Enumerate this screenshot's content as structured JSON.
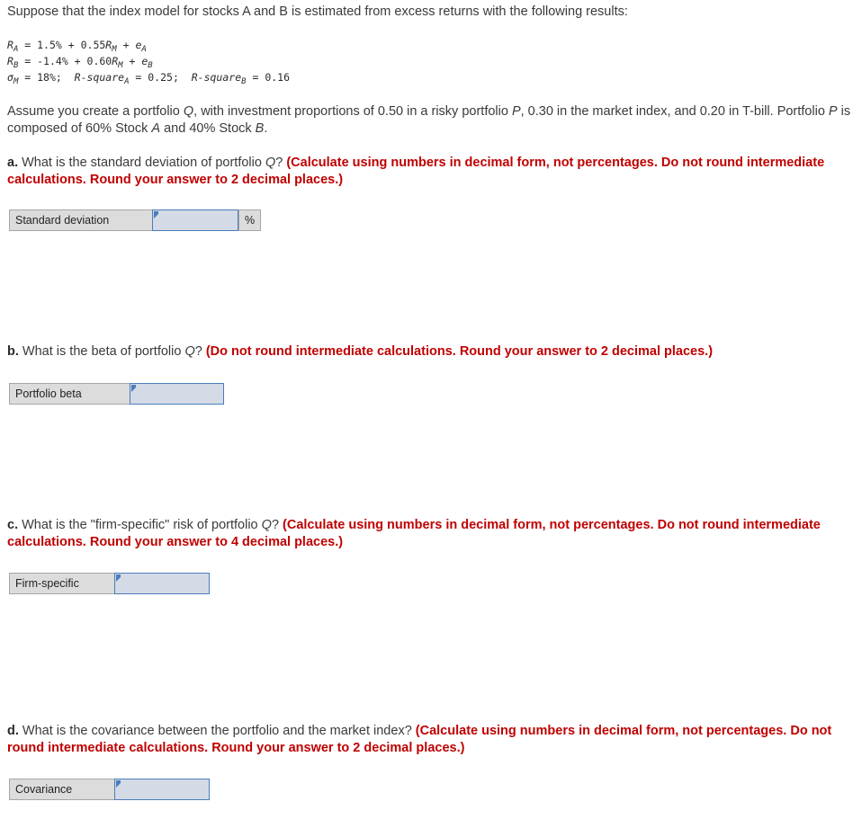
{
  "intro": {
    "text": "Suppose that the index model for stocks A and B is estimated from excess returns with the following results:"
  },
  "formulas": {
    "line1": {
      "lhs_var": "R",
      "lhs_sub": "A",
      "body_pre": " = 1.5% + 0.55",
      "mid_var": "R",
      "mid_sub": "M",
      "body_post": " + ",
      "err_var": "e",
      "err_sub": "A"
    },
    "line2": {
      "lhs_var": "R",
      "lhs_sub": "B",
      "body_pre": " = -1.4% + 0.60",
      "mid_var": "R",
      "mid_sub": "M",
      "body_post": " + ",
      "err_var": "e",
      "err_sub": "B"
    },
    "line3": {
      "sigma_var": "σ",
      "sigma_sub": "M",
      "sigma_val": " = 18%;  ",
      "rsq1_var": "R-square",
      "rsq1_sub": "A",
      "rsq1_val": " = 0.25;  ",
      "rsq2_var": "R-square",
      "rsq2_sub": "B",
      "rsq2_val": " = 0.16"
    }
  },
  "assume": {
    "part1": "Assume you create a portfolio ",
    "var_q": "Q",
    "part2": ", with investment proportions of 0.50 in a risky portfolio ",
    "var_p": "P",
    "part3": ", 0.30 in the market index, and 0.20 in T-bill. Portfolio ",
    "var_p2": "P",
    "part4": " is composed of 60% Stock ",
    "var_a": "A",
    "part5": " and 40% Stock ",
    "var_b": "B",
    "part6": "."
  },
  "questions": [
    {
      "letter": "a.",
      "text_before": " What is the standard deviation of portfolio ",
      "variable": "Q",
      "text_after": "? ",
      "note": "(Calculate using numbers in decimal form, not percentages. Do not round intermediate calculations. Round your answer to 2 decimal places.)",
      "answer": {
        "label": "Standard deviation",
        "value": "",
        "placeholder": "",
        "suffix": "%"
      }
    },
    {
      "letter": "b.",
      "text_before": " What is the beta of portfolio ",
      "variable": "Q",
      "text_after": "? ",
      "note": "(Do not round intermediate calculations. Round your answer to 2 decimal places.)",
      "answer": {
        "label": "Portfolio beta",
        "value": "",
        "placeholder": "",
        "suffix": ""
      }
    },
    {
      "letter": "c.",
      "text_before": " What is the \"firm-specific\" risk of portfolio ",
      "variable": "Q",
      "text_after": "? ",
      "note": "(Calculate using numbers in decimal form, not percentages. Do not round intermediate calculations. Round your answer to 4 decimal places.)",
      "answer": {
        "label": "Firm-specific",
        "value": "",
        "placeholder": "",
        "suffix": ""
      }
    },
    {
      "letter": "d.",
      "text_before": " What is the covariance between the portfolio and the market index? ",
      "variable": "",
      "text_after": "",
      "note": "(Calculate using numbers in decimal form, not percentages. Do not round intermediate calculations. Round your answer to 2 decimal places.)",
      "answer": {
        "label": "Covariance",
        "value": "",
        "placeholder": "",
        "suffix": ""
      }
    }
  ],
  "colors": {
    "note_red": "#c00000",
    "input_fill": "#d4dae6",
    "input_border": "#4a7ebb",
    "label_fill": "#dcdcdc",
    "label_border": "#a6a6a6",
    "body_text": "#3a3a3a"
  }
}
